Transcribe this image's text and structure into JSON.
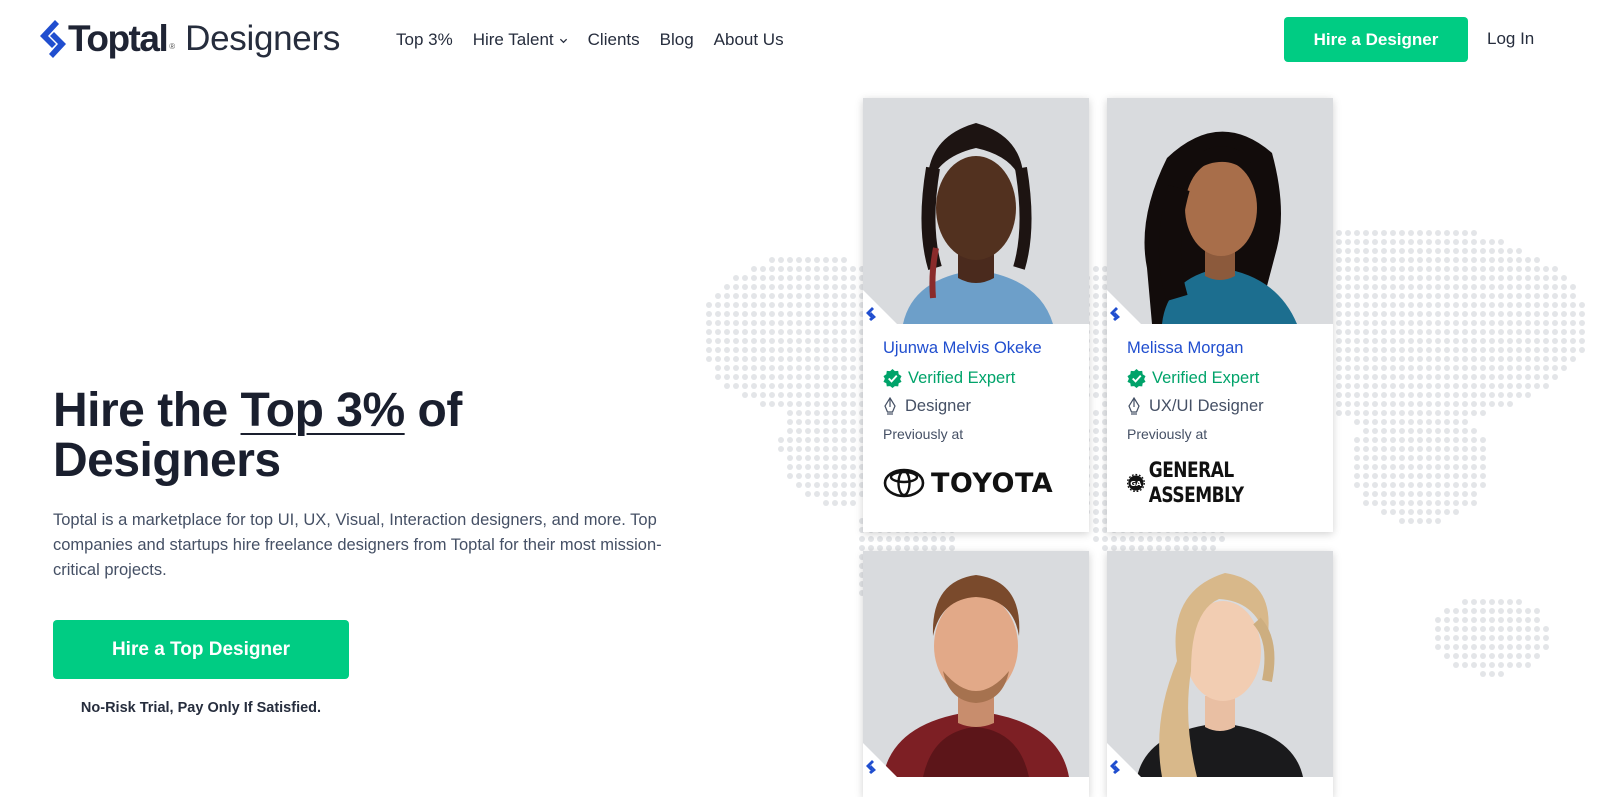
{
  "header": {
    "logo_word": "Toptal",
    "logo_reg": "®",
    "logo_sub": "Designers",
    "nav": [
      {
        "label": "Top 3%"
      },
      {
        "label": "Hire Talent"
      },
      {
        "label": "Clients"
      },
      {
        "label": "Blog"
      },
      {
        "label": "About Us"
      }
    ],
    "cta_label": "Hire a Designer",
    "login_label": "Log In"
  },
  "hero": {
    "title_pre": "Hire the ",
    "title_highlight": "Top 3%",
    "title_post": " of",
    "title_line2": "Designers",
    "description": "Toptal is a marketplace for top UI, UX, Visual, Interaction designers, and more. Top companies and startups hire freelance designers from Toptal for their most mission-critical projects.",
    "cta_label": "Hire a Top Designer",
    "risk_text": "No-Risk Trial, Pay Only If Satisfied."
  },
  "cards": [
    {
      "name": "Ujunwa Melvis Okeke",
      "verified": "Verified Expert",
      "role": "Designer",
      "previously": "Previously at",
      "company": "TOYOTA"
    },
    {
      "name": "Melissa Morgan",
      "verified": "Verified Expert",
      "role": "UX/UI Designer",
      "previously": "Previously at",
      "company": "GENERAL ASSEMBLY"
    }
  ],
  "colors": {
    "brand_blue": "#204ecf",
    "accent_green": "#00cc83",
    "verified_green": "#00a36a"
  }
}
